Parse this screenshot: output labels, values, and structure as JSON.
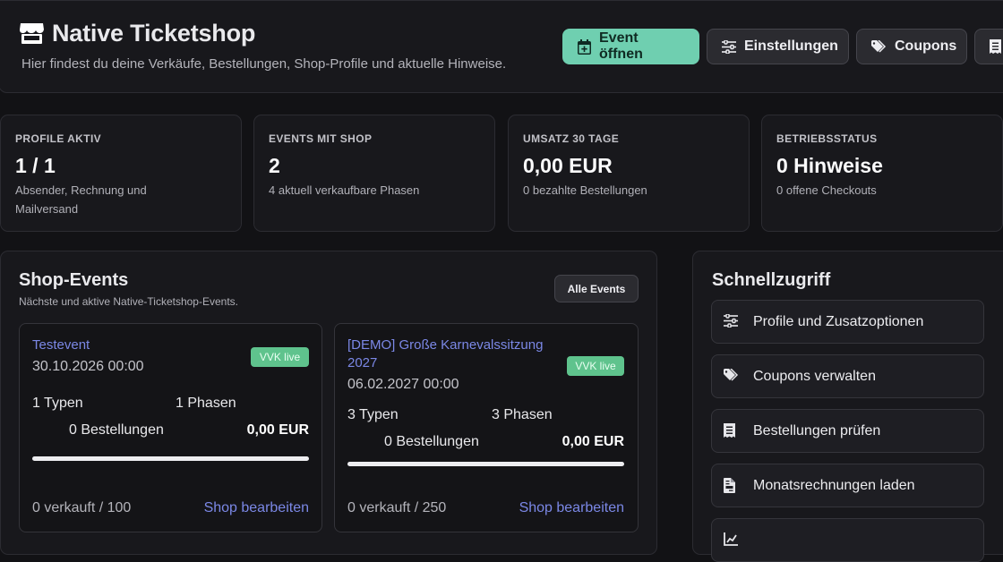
{
  "header": {
    "title": "Native Ticketshop",
    "subtitle": "Hier findest du deine Verkäufe, Bestellungen, Shop-Profile und aktuelle Hinweise.",
    "buttons": {
      "event": "Event öffnen",
      "settings": "Einstellungen",
      "coupons": "Coupons"
    }
  },
  "stats": [
    {
      "label": "PROFILE AKTIV",
      "value": "1 / 1",
      "note": "Absender, Rechnung und Mailversand"
    },
    {
      "label": "EVENTS MIT SHOP",
      "value": "2",
      "note": "4 aktuell verkaufbare Phasen"
    },
    {
      "label": "UMSATZ 30 TAGE",
      "value": "0,00 EUR",
      "note": "0 bezahlte Bestellungen"
    },
    {
      "label": "BETRIEBSSTATUS",
      "value": "0 Hinweise",
      "note": "0 offene Checkouts"
    }
  ],
  "events": {
    "title": "Shop-Events",
    "subtitle": "Nächste und aktive Native-Ticketshop-Events.",
    "all_button": "Alle Events",
    "items": [
      {
        "name": "Testevent",
        "date": "30.10.2026 00:00",
        "badge": "VVK live",
        "types": "1 Typen",
        "phases": "1 Phasen",
        "orders": "0 Bestellungen",
        "amount": "0,00 EUR",
        "progress": 0,
        "sold": "0 verkauft / 100",
        "edit": "Shop bearbeiten"
      },
      {
        "name": "[DEMO] Große Karnevalssitzung 2027",
        "date": "06.02.2027 00:00",
        "badge": "VVK live",
        "types": "3 Typen",
        "phases": "3 Phasen",
        "orders": "0 Bestellungen",
        "amount": "0,00 EUR",
        "progress": 0,
        "sold": "0 verkauft / 250",
        "edit": "Shop bearbeiten"
      }
    ]
  },
  "quick": {
    "title": "Schnellzugriff",
    "items": [
      {
        "label": "Profile und Zusatzoptionen",
        "icon": "sliders-icon"
      },
      {
        "label": "Coupons verwalten",
        "icon": "tags-icon"
      },
      {
        "label": "Bestellungen prüfen",
        "icon": "receipt-icon"
      },
      {
        "label": "Monatsrechnungen laden",
        "icon": "file-invoice-icon"
      },
      {
        "label": "",
        "icon": "chart-icon"
      }
    ]
  },
  "colors": {
    "accent": "#6fcfb0",
    "link": "#7b88e6",
    "live_badge": "#5fc38d",
    "background": "#121215"
  }
}
